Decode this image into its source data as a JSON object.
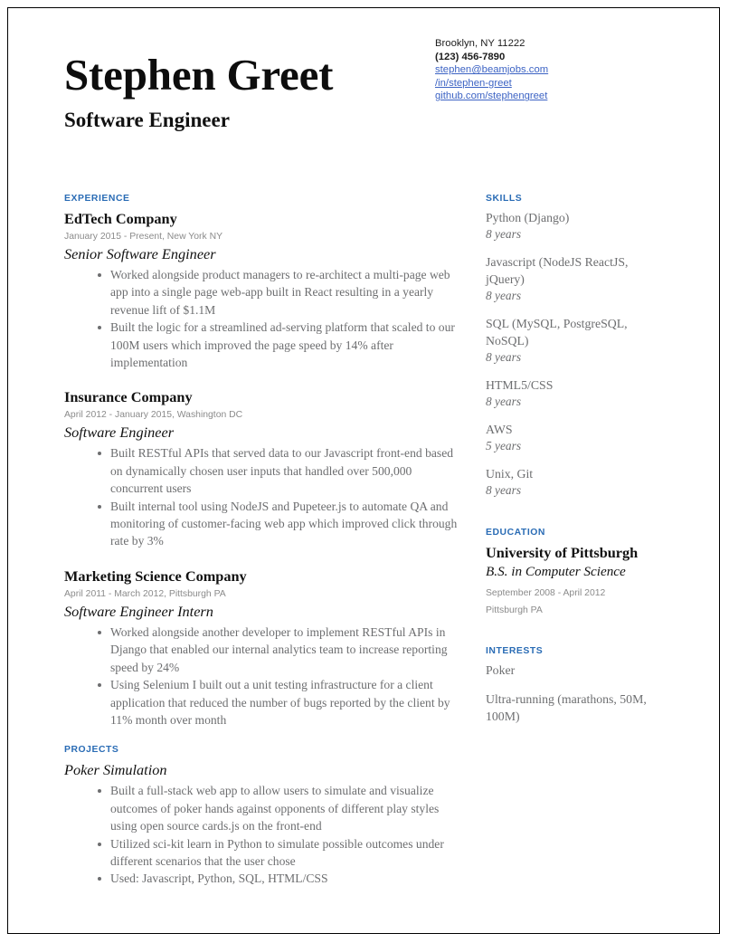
{
  "document": {
    "type": "resume",
    "accent_color": "#2a6cb5",
    "link_color": "#3c63c4",
    "body_text_color": "#6d6e70",
    "meta_text_color": "#8b8b8b"
  },
  "header": {
    "name": "Stephen Greet",
    "job_title": "Software Engineer",
    "contact": {
      "location": "Brooklyn, NY 11222",
      "phone": "(123) 456-7890",
      "email": "stephen@beamjobs.com",
      "linkedin": "/in/stephen-greet",
      "github": "github.com/stephengreet"
    }
  },
  "left_column": {
    "experience": {
      "heading": "EXPERIENCE",
      "entries": [
        {
          "company": "EdTech Company",
          "meta": "January 2015 - Present, New York NY",
          "role": "Senior Software Engineer",
          "bullets": [
            "Worked alongside product managers to re-architect a multi-page web app into a single page web-app built in React resulting in a yearly revenue lift of $1.1M",
            "Built the logic for  a streamlined ad-serving platform that scaled to our 100M users which improved the page speed by 14% after implementation"
          ]
        },
        {
          "company": "Insurance Company",
          "meta": "April 2012 - January 2015, Washington DC",
          "role": "Software Engineer",
          "bullets": [
            "Built RESTful APIs that served data to our Javascript front-end based on dynamically chosen user inputs that handled over 500,000 concurrent users",
            "Built internal tool using NodeJS and Pupeteer.js to automate QA and monitoring of customer-facing web app which improved click through rate by 3%"
          ]
        },
        {
          "company": "Marketing Science Company",
          "meta": "April 2011 - March 2012, Pittsburgh PA",
          "role": "Software Engineer Intern",
          "bullets": [
            "Worked alongside another developer to implement RESTful APIs in Django that enabled our internal analytics team to increase reporting speed by 24%",
            "Using Selenium I built out a unit testing infrastructure for a client application that reduced the number of bugs reported by the client by 11% month over month"
          ]
        }
      ]
    },
    "projects": {
      "heading": "PROJECTS",
      "entries": [
        {
          "title": "Poker Simulation",
          "bullets": [
            "Built a full-stack web app to allow users to simulate and visualize outcomes of poker hands against opponents of different play styles using open source cards.js on the front-end",
            "Utilized  sci-kit learn in Python to simulate possible outcomes under different scenarios that the user chose",
            "Used: Javascript, Python, SQL, HTML/CSS"
          ]
        }
      ]
    }
  },
  "right_column": {
    "skills": {
      "heading": "SKILLS",
      "items": [
        {
          "name": "Python (Django)",
          "years": "8 years"
        },
        {
          "name": "Javascript (NodeJS ReactJS, jQuery)",
          "years": "8 years"
        },
        {
          "name": "SQL  (MySQL, PostgreSQL, NoSQL)",
          "years": "8 years"
        },
        {
          "name": "HTML5/CSS",
          "years": "8 years"
        },
        {
          "name": "AWS",
          "years": "5 years"
        },
        {
          "name": "Unix, Git",
          "years": "8 years"
        }
      ]
    },
    "education": {
      "heading": "EDUCATION",
      "school": "University of Pittsburgh",
      "degree": "B.S. in Computer Science",
      "dates": "September 2008 - April 2012",
      "location": "Pittsburgh PA"
    },
    "interests": {
      "heading": "INTERESTS",
      "items": [
        "Poker",
        "Ultra-running (marathons, 50M, 100M)"
      ]
    }
  }
}
